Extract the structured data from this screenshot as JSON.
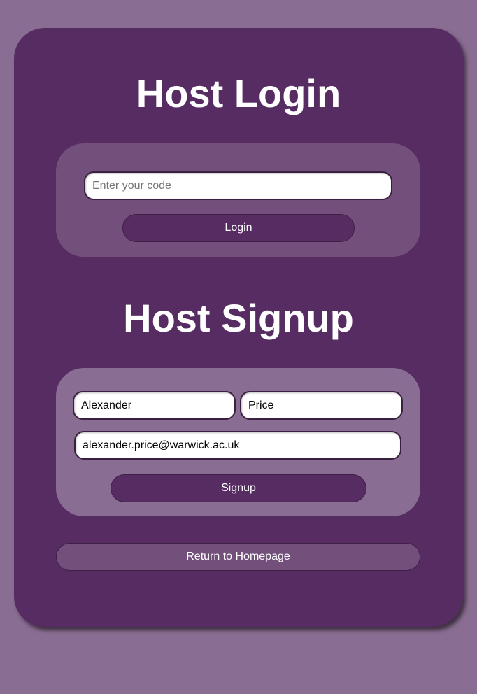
{
  "login": {
    "title": "Host Login",
    "code_placeholder": "Enter your code",
    "code_value": "",
    "button_label": "Login"
  },
  "signup": {
    "title": "Host Signup",
    "first_name_value": "Alexander",
    "last_name_value": "Price",
    "email_value": "alexander.price@warwick.ac.uk",
    "button_label": "Signup"
  },
  "footer": {
    "return_label": "Return to Homepage"
  },
  "colors": {
    "background": "#8a6d92",
    "card": "#572c63",
    "login_panel": "#73507c",
    "signup_panel": "#8a6d92"
  }
}
